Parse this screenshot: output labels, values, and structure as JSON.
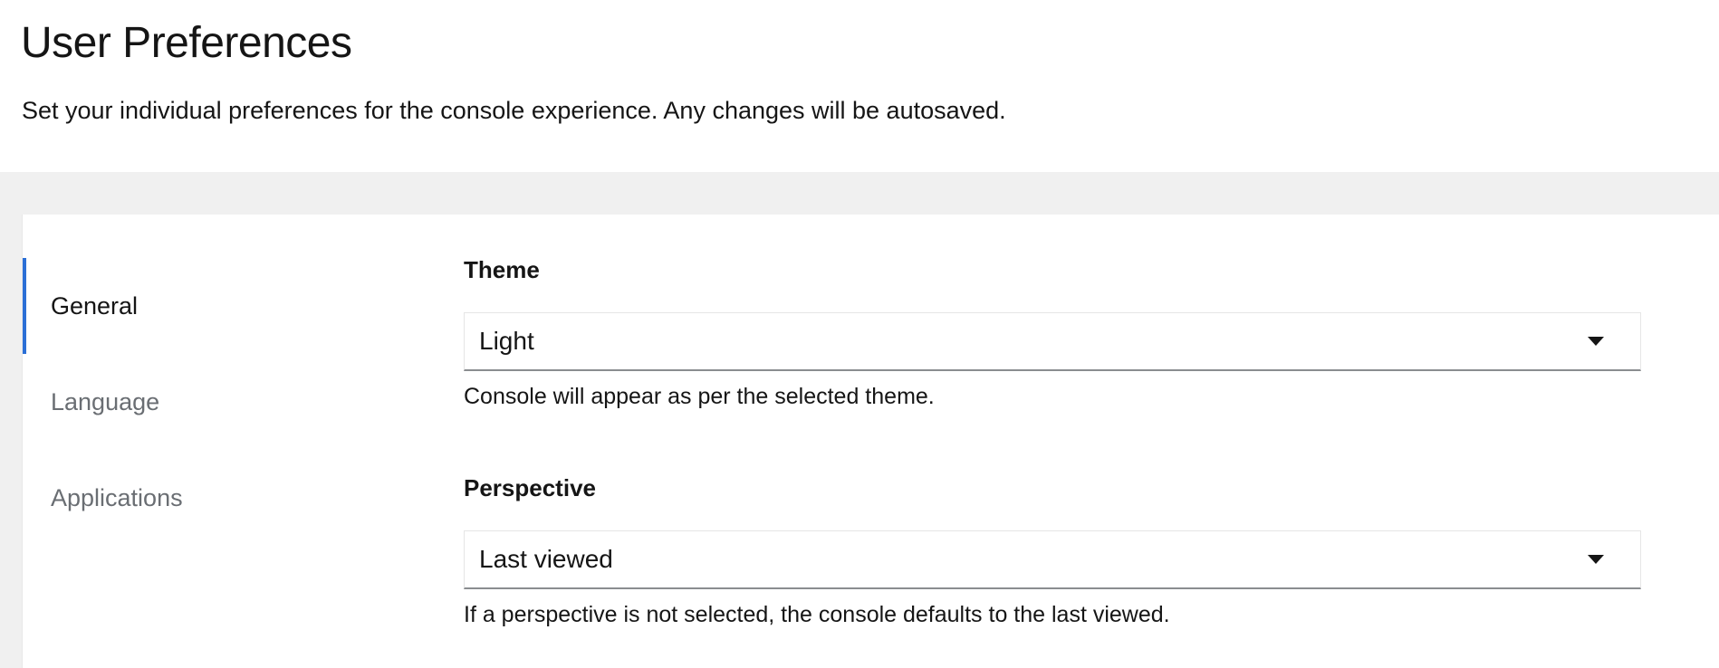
{
  "header": {
    "title": "User Preferences",
    "description": "Set your individual preferences for the console experience. Any changes will be autosaved."
  },
  "tabs": [
    {
      "label": "General",
      "active": true
    },
    {
      "label": "Language",
      "active": false
    },
    {
      "label": "Applications",
      "active": false
    }
  ],
  "fields": {
    "theme": {
      "label": "Theme",
      "value": "Light",
      "helper": "Console will appear as per the selected theme."
    },
    "perspective": {
      "label": "Perspective",
      "value": "Last viewed",
      "helper": "If a perspective is not selected, the console defaults to the last viewed."
    }
  },
  "colors": {
    "accent": "#2b6fd6",
    "background": "#f0f0f0",
    "inactive_tab": "#6a6e73"
  },
  "icons": {
    "dropdown": "caret-down-icon"
  }
}
